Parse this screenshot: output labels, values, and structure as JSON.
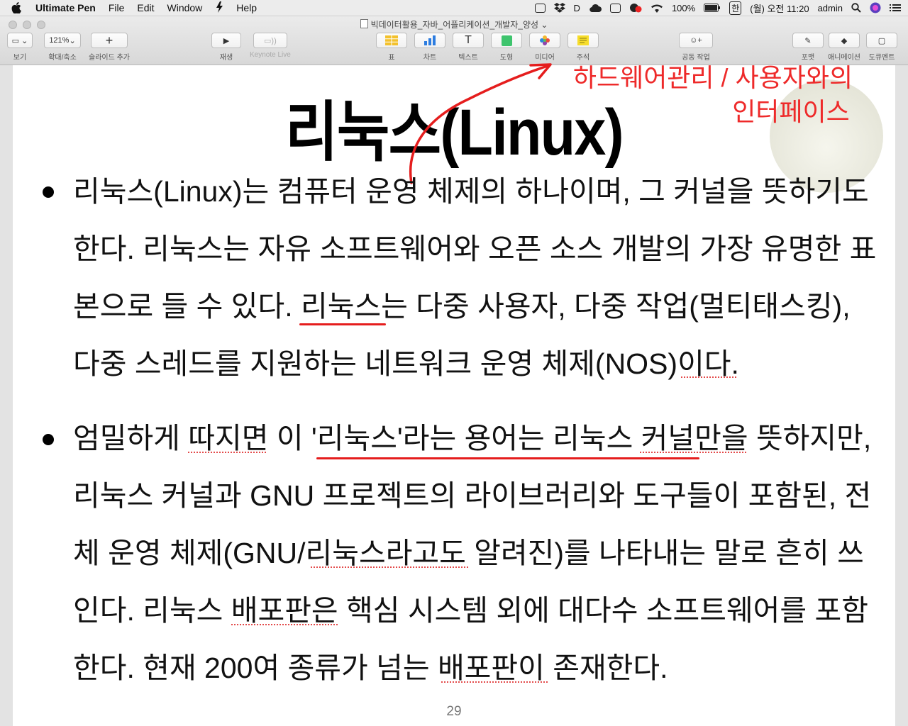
{
  "menubar": {
    "app_name": "Ultimate Pen",
    "items": [
      "File",
      "Edit",
      "Window",
      "Help"
    ],
    "battery": "100%",
    "ime": "한",
    "clock": "(월) 오전 11:20",
    "user": "admin"
  },
  "window": {
    "title": "빅데이터활용_자바_어플리케이션_개발자_양성"
  },
  "toolbar": {
    "view_label": "보기",
    "zoom_value": "121%",
    "zoom_label": "확대/축소",
    "add_slide_label": "슬라이드 추가",
    "play_label": "재생",
    "keynote_live_label": "Keynote Live",
    "table_label": "표",
    "chart_label": "차트",
    "text_label": "텍스트",
    "shape_label": "도형",
    "media_label": "미디어",
    "comment_label": "주석",
    "collaborate_label": "공동 작업",
    "format_label": "포맷",
    "animate_label": "애니메이션",
    "document_label": "도큐멘트"
  },
  "slide": {
    "title": "리눅스(Linux)",
    "annotation_line1": "하드웨어관리 / 사용자와의",
    "annotation_line2": "인터페이스",
    "bullets": [
      {
        "lines": [
          "리눅스(Linux)는 컴퓨터 운영 체제의 하나이며, 그 커널을 뜻하기도",
          "한다. 리눅스는 자유 소프트웨어와 오픈 소스 개발의 가장 유명한 표",
          "본으로 들 수 있다. 리눅스는 다중 사용자, 다중 작업(멀티태스킹),",
          "다중 스레드를 지원하는 네트워크 운영 체제(NOS)이다."
        ]
      },
      {
        "lines": [
          "엄밀하게 따지면 이 '리눅스'라는 용어는 리눅스 커널만을 뜻하지만,",
          "리눅스 커널과 GNU 프로젝트의 라이브러리와 도구들이 포함된, 전",
          "체 운영 체제(GNU/리눅스라고도 알려진)를 나타내는 말로 흔히 쓰",
          "인다. 리눅스 배포판은 핵심 시스템 외에 대다수 소프트웨어를 포함",
          "한다. 현재 200여 종류가 넘는 배포판이 존재한다."
        ]
      }
    ],
    "page_number": "29"
  }
}
